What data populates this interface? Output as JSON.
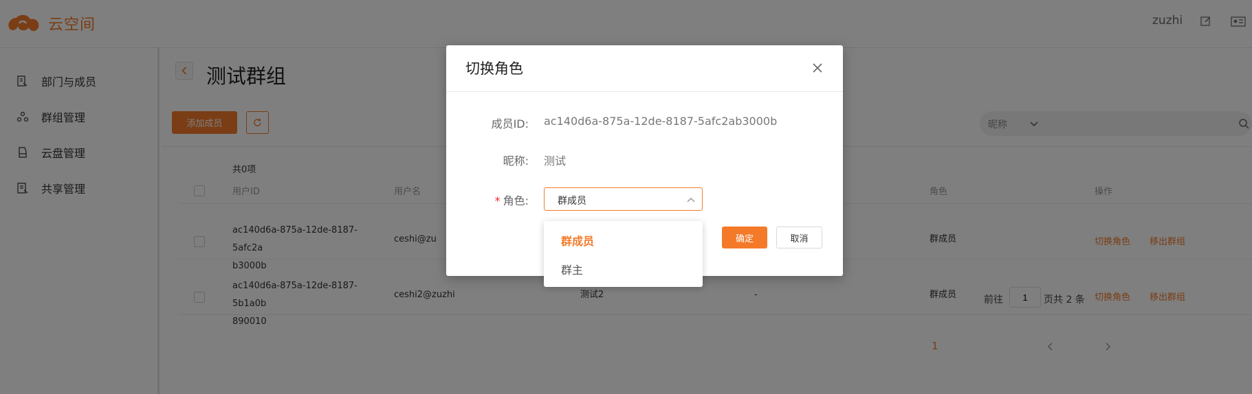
{
  "app": {
    "logo_text": "云空间",
    "user": "zuzhi"
  },
  "sidebar": {
    "items": [
      {
        "label": "部门与成员",
        "icon": "department-icon"
      },
      {
        "label": "群组管理",
        "icon": "group-icon"
      },
      {
        "label": "云盘管理",
        "icon": "cloud-disk-icon"
      },
      {
        "label": "共享管理",
        "icon": "share-icon"
      }
    ]
  },
  "page": {
    "title": "测试群组",
    "add_member_label": "添加成员",
    "search": {
      "field": "昵称",
      "value": ""
    },
    "count_text": "共0项",
    "columns": [
      "用户ID",
      "用户名",
      "角色",
      "操作"
    ],
    "rows": [
      {
        "user_id_line1": "ac140d6a-875a-12de-8187-5afc2a",
        "user_id_line2": "b3000b",
        "username": "ceshi@zu",
        "nickname": "",
        "extra": "",
        "role": "群成员",
        "op1": "切换角色",
        "op2": "移出群组"
      },
      {
        "user_id_line1": "ac140d6a-875a-12de-8187-5b1a0b",
        "user_id_line2": "890010",
        "username": "ceshi2@zuzhi",
        "nickname": "测试2",
        "extra": "-",
        "role": "群成员",
        "op1": "切换角色",
        "op2": "移出群组"
      }
    ],
    "pagination": {
      "current_page": "1",
      "goto_label": "前往",
      "goto_value": "1",
      "total_text": "页共 2 条"
    }
  },
  "modal": {
    "title": "切换角色",
    "member_id_label": "成员ID:",
    "member_id_value": "ac140d6a-875a-12de-8187-5afc2ab3000b",
    "nickname_label": "昵称:",
    "nickname_value": "测试",
    "role_required_mark": "*",
    "role_label": "角色:",
    "role_value": "群成员",
    "ok_label": "确定",
    "cancel_label": "取消",
    "role_options": [
      "群成员",
      "群主"
    ]
  },
  "colors": {
    "accent": "#f47a2a",
    "overlay": "rgba(0,0,0,0.5)"
  }
}
